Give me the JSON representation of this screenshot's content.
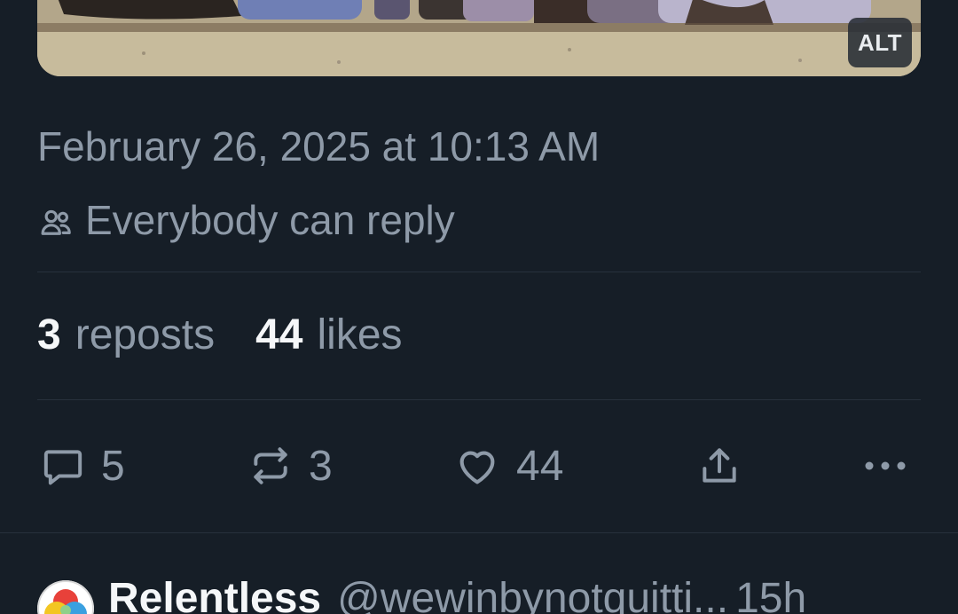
{
  "post": {
    "media": {
      "alt_badge": "ALT"
    },
    "timestamp": "February 26, 2025 at 10:13 AM",
    "reply_setting": "Everybody can reply",
    "stats": {
      "reposts_count": "3",
      "reposts_label": "reposts",
      "likes_count": "44",
      "likes_label": "likes"
    },
    "actions": {
      "reply_count": "5",
      "repost_count": "3",
      "like_count": "44",
      "icons": [
        "reply-icon",
        "repost-icon",
        "heart-icon",
        "share-icon",
        "more-icon"
      ]
    }
  },
  "next_reply": {
    "display_name": "Relentless",
    "handle": "@wewinbynotquitti...",
    "time": "15h"
  },
  "colors": {
    "background": "#161e27",
    "muted_text": "#8e9aa8",
    "primary_text": "#f5f7f9",
    "divider": "#27313c"
  }
}
